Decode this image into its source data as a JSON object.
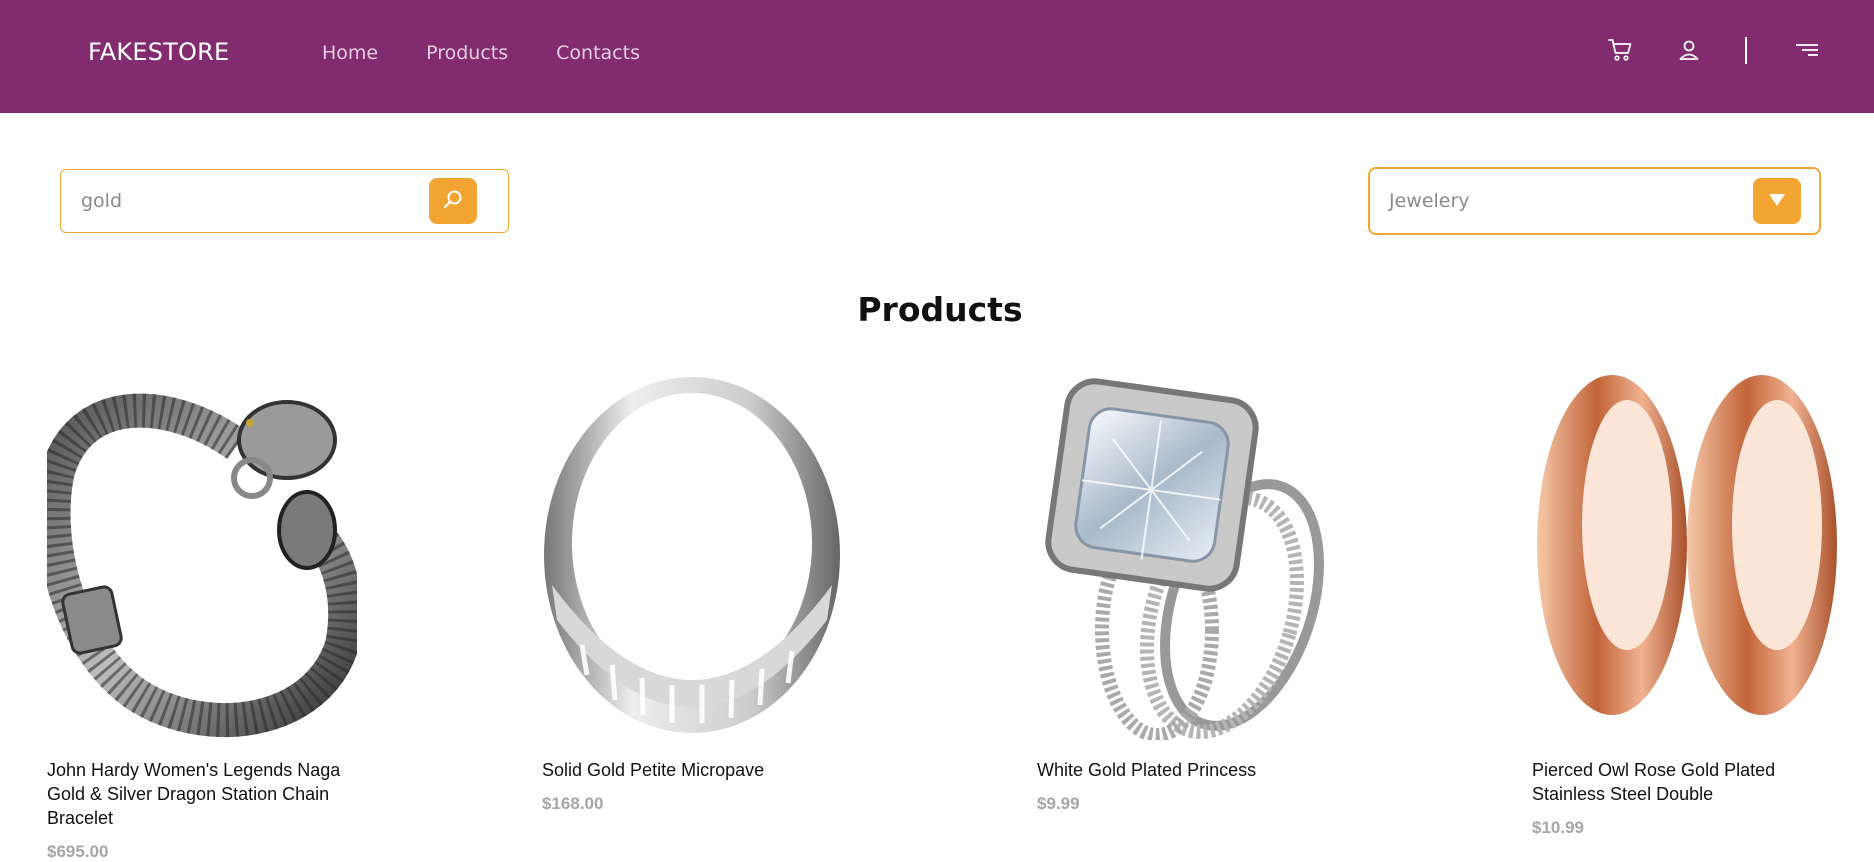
{
  "header": {
    "brand": "FAKESTORE",
    "nav": [
      "Home",
      "Products",
      "Contacts"
    ],
    "icons": [
      "cart-icon",
      "user-icon",
      "menu-icon"
    ]
  },
  "search": {
    "value": "gold",
    "placeholder": ""
  },
  "category": {
    "selected": "Jewelery"
  },
  "section": {
    "title": "Products"
  },
  "products": [
    {
      "title": "John Hardy Women's Legends Naga Gold & Silver Dragon Station Chain Bracelet",
      "price": "$695.00",
      "image": "dragon-bracelet"
    },
    {
      "title": "Solid Gold Petite Micropave",
      "price": "$168.00",
      "image": "silver-band-ring"
    },
    {
      "title": "White Gold Plated Princess",
      "price": "$9.99",
      "image": "diamond-ring-set"
    },
    {
      "title": "Pierced Owl Rose Gold Plated Stainless Steel Double",
      "price": "$10.99",
      "image": "rose-gold-tunnels"
    }
  ],
  "colors": {
    "header_bg": "#822b6f",
    "accent": "#f3a533",
    "price": "#a6a6a6"
  }
}
